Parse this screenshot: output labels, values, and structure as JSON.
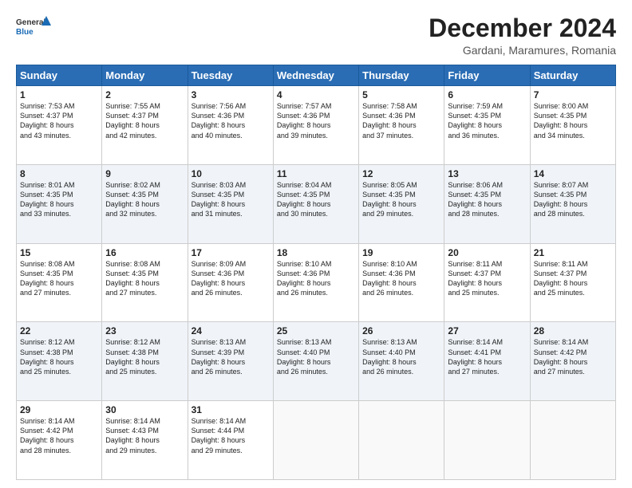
{
  "header": {
    "logo_general": "General",
    "logo_blue": "Blue",
    "month_title": "December 2024",
    "subtitle": "Gardani, Maramures, Romania"
  },
  "weekdays": [
    "Sunday",
    "Monday",
    "Tuesday",
    "Wednesday",
    "Thursday",
    "Friday",
    "Saturday"
  ],
  "weeks": [
    [
      {
        "day": "1",
        "lines": [
          "Sunrise: 7:53 AM",
          "Sunset: 4:37 PM",
          "Daylight: 8 hours",
          "and 43 minutes."
        ]
      },
      {
        "day": "2",
        "lines": [
          "Sunrise: 7:55 AM",
          "Sunset: 4:37 PM",
          "Daylight: 8 hours",
          "and 42 minutes."
        ]
      },
      {
        "day": "3",
        "lines": [
          "Sunrise: 7:56 AM",
          "Sunset: 4:36 PM",
          "Daylight: 8 hours",
          "and 40 minutes."
        ]
      },
      {
        "day": "4",
        "lines": [
          "Sunrise: 7:57 AM",
          "Sunset: 4:36 PM",
          "Daylight: 8 hours",
          "and 39 minutes."
        ]
      },
      {
        "day": "5",
        "lines": [
          "Sunrise: 7:58 AM",
          "Sunset: 4:36 PM",
          "Daylight: 8 hours",
          "and 37 minutes."
        ]
      },
      {
        "day": "6",
        "lines": [
          "Sunrise: 7:59 AM",
          "Sunset: 4:35 PM",
          "Daylight: 8 hours",
          "and 36 minutes."
        ]
      },
      {
        "day": "7",
        "lines": [
          "Sunrise: 8:00 AM",
          "Sunset: 4:35 PM",
          "Daylight: 8 hours",
          "and 34 minutes."
        ]
      }
    ],
    [
      {
        "day": "8",
        "lines": [
          "Sunrise: 8:01 AM",
          "Sunset: 4:35 PM",
          "Daylight: 8 hours",
          "and 33 minutes."
        ]
      },
      {
        "day": "9",
        "lines": [
          "Sunrise: 8:02 AM",
          "Sunset: 4:35 PM",
          "Daylight: 8 hours",
          "and 32 minutes."
        ]
      },
      {
        "day": "10",
        "lines": [
          "Sunrise: 8:03 AM",
          "Sunset: 4:35 PM",
          "Daylight: 8 hours",
          "and 31 minutes."
        ]
      },
      {
        "day": "11",
        "lines": [
          "Sunrise: 8:04 AM",
          "Sunset: 4:35 PM",
          "Daylight: 8 hours",
          "and 30 minutes."
        ]
      },
      {
        "day": "12",
        "lines": [
          "Sunrise: 8:05 AM",
          "Sunset: 4:35 PM",
          "Daylight: 8 hours",
          "and 29 minutes."
        ]
      },
      {
        "day": "13",
        "lines": [
          "Sunrise: 8:06 AM",
          "Sunset: 4:35 PM",
          "Daylight: 8 hours",
          "and 28 minutes."
        ]
      },
      {
        "day": "14",
        "lines": [
          "Sunrise: 8:07 AM",
          "Sunset: 4:35 PM",
          "Daylight: 8 hours",
          "and 28 minutes."
        ]
      }
    ],
    [
      {
        "day": "15",
        "lines": [
          "Sunrise: 8:08 AM",
          "Sunset: 4:35 PM",
          "Daylight: 8 hours",
          "and 27 minutes."
        ]
      },
      {
        "day": "16",
        "lines": [
          "Sunrise: 8:08 AM",
          "Sunset: 4:35 PM",
          "Daylight: 8 hours",
          "and 27 minutes."
        ]
      },
      {
        "day": "17",
        "lines": [
          "Sunrise: 8:09 AM",
          "Sunset: 4:36 PM",
          "Daylight: 8 hours",
          "and 26 minutes."
        ]
      },
      {
        "day": "18",
        "lines": [
          "Sunrise: 8:10 AM",
          "Sunset: 4:36 PM",
          "Daylight: 8 hours",
          "and 26 minutes."
        ]
      },
      {
        "day": "19",
        "lines": [
          "Sunrise: 8:10 AM",
          "Sunset: 4:36 PM",
          "Daylight: 8 hours",
          "and 26 minutes."
        ]
      },
      {
        "day": "20",
        "lines": [
          "Sunrise: 8:11 AM",
          "Sunset: 4:37 PM",
          "Daylight: 8 hours",
          "and 25 minutes."
        ]
      },
      {
        "day": "21",
        "lines": [
          "Sunrise: 8:11 AM",
          "Sunset: 4:37 PM",
          "Daylight: 8 hours",
          "and 25 minutes."
        ]
      }
    ],
    [
      {
        "day": "22",
        "lines": [
          "Sunrise: 8:12 AM",
          "Sunset: 4:38 PM",
          "Daylight: 8 hours",
          "and 25 minutes."
        ]
      },
      {
        "day": "23",
        "lines": [
          "Sunrise: 8:12 AM",
          "Sunset: 4:38 PM",
          "Daylight: 8 hours",
          "and 25 minutes."
        ]
      },
      {
        "day": "24",
        "lines": [
          "Sunrise: 8:13 AM",
          "Sunset: 4:39 PM",
          "Daylight: 8 hours",
          "and 26 minutes."
        ]
      },
      {
        "day": "25",
        "lines": [
          "Sunrise: 8:13 AM",
          "Sunset: 4:40 PM",
          "Daylight: 8 hours",
          "and 26 minutes."
        ]
      },
      {
        "day": "26",
        "lines": [
          "Sunrise: 8:13 AM",
          "Sunset: 4:40 PM",
          "Daylight: 8 hours",
          "and 26 minutes."
        ]
      },
      {
        "day": "27",
        "lines": [
          "Sunrise: 8:14 AM",
          "Sunset: 4:41 PM",
          "Daylight: 8 hours",
          "and 27 minutes."
        ]
      },
      {
        "day": "28",
        "lines": [
          "Sunrise: 8:14 AM",
          "Sunset: 4:42 PM",
          "Daylight: 8 hours",
          "and 27 minutes."
        ]
      }
    ],
    [
      {
        "day": "29",
        "lines": [
          "Sunrise: 8:14 AM",
          "Sunset: 4:42 PM",
          "Daylight: 8 hours",
          "and 28 minutes."
        ]
      },
      {
        "day": "30",
        "lines": [
          "Sunrise: 8:14 AM",
          "Sunset: 4:43 PM",
          "Daylight: 8 hours",
          "and 29 minutes."
        ]
      },
      {
        "day": "31",
        "lines": [
          "Sunrise: 8:14 AM",
          "Sunset: 4:44 PM",
          "Daylight: 8 hours",
          "and 29 minutes."
        ]
      },
      {
        "day": "",
        "lines": []
      },
      {
        "day": "",
        "lines": []
      },
      {
        "day": "",
        "lines": []
      },
      {
        "day": "",
        "lines": []
      }
    ]
  ]
}
